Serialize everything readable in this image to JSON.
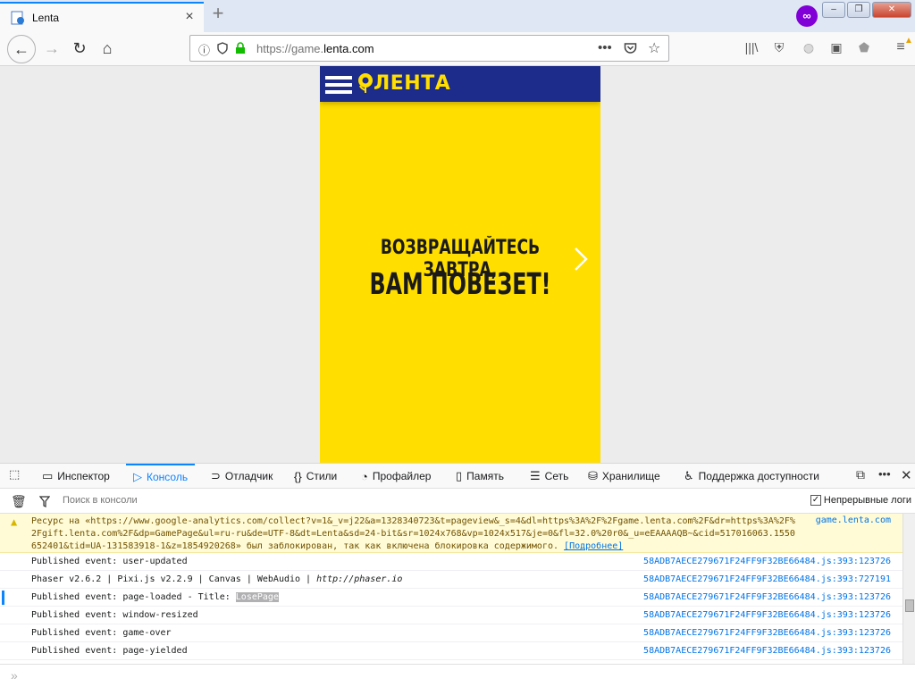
{
  "browser": {
    "tab_title": "Lenta",
    "new_tab_icon": "plus-icon",
    "privacy_label": "∞",
    "window_buttons": [
      "–",
      "❐",
      "✕"
    ]
  },
  "navbar": {
    "url_prefix": "https://game.",
    "url_domain": "lenta.com",
    "url_suffix": ""
  },
  "game": {
    "brand": "ЛЕНТА",
    "line1": "ВОЗВРАЩАЙТЕСЬ ЗАВТРА,",
    "line2": "ВАМ ПОВЕЗЕТ!",
    "colors": {
      "header": "#1d2c8a",
      "background": "#ffde00",
      "logo": "#ffde00"
    }
  },
  "devtools": {
    "tabs": [
      {
        "label": "Инспектор",
        "icon": "inspector-icon"
      },
      {
        "label": "Консоль",
        "icon": "console-icon",
        "active": true
      },
      {
        "label": "Отладчик",
        "icon": "debugger-icon"
      },
      {
        "label": "Стили",
        "icon": "style-editor-icon"
      },
      {
        "label": "Профайлер",
        "icon": "profiler-icon"
      },
      {
        "label": "Память",
        "icon": "memory-icon"
      },
      {
        "label": "Сеть",
        "icon": "network-icon"
      },
      {
        "label": "Хранилище",
        "icon": "storage-icon"
      },
      {
        "label": "Поддержка доступности",
        "icon": "accessibility-icon"
      }
    ],
    "filter_placeholder": "Поиск в консоли",
    "persist_label": "Непрерывные логи",
    "warning": {
      "text": "Ресурс на «https://www.google-analytics.com/collect?v=1&_v=j22&a=1328340723&t=pageview&_s=4&dl=https%3A%2F%2Fgame.lenta.com%2F&dr=https%3A%2F%2Fgift.lenta.com%2F&dp=GamePage&ul=ru-ru&de=UTF-8&dt=Lenta&sd=24-bit&sr=1024x768&vp=1024x517&je=0&fl=32.0%20r0&_u=eEAAAAQB~&cid=517016063.1550652401&tid=UA-131583918-1&z=1854920268» был заблокирован, так как включена блокировка содержимого.",
      "link": "[Подробнее]",
      "source": "game.lenta.com"
    },
    "rows": [
      {
        "text": "Published event: user-updated",
        "source": "58ADB7AECE279671F24FF9F32BE66484.js:393:123726"
      },
      {
        "text_a": "Phaser v2.6.2 | Pixi.js v2.2.9 | Canvas | WebAudio | ",
        "text_b": "http://phaser.io",
        "source": "58ADB7AECE279671F24FF9F32BE66484.js:393:727191"
      },
      {
        "text_a": "Published event: page-loaded - Title: ",
        "text_b": "LosePage",
        "source": "58ADB7AECE279671F24FF9F32BE66484.js:393:123726"
      },
      {
        "text": "Published event: window-resized",
        "source": "58ADB7AECE279671F24FF9F32BE66484.js:393:123726"
      },
      {
        "text": "Published event: game-over",
        "source": "58ADB7AECE279671F24FF9F32BE66484.js:393:123726"
      },
      {
        "text": "Published event: page-yielded",
        "source": "58ADB7AECE279671F24FF9F32BE66484.js:393:123726"
      }
    ]
  }
}
